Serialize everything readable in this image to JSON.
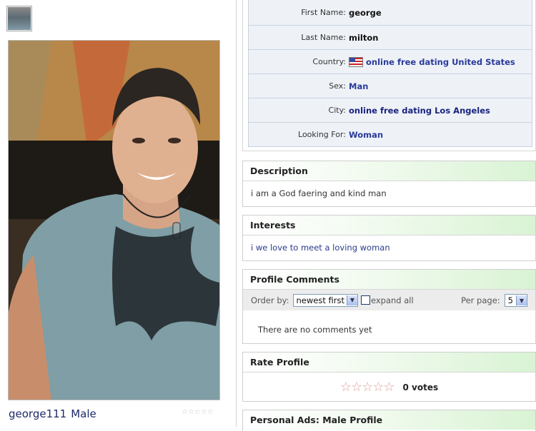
{
  "profile": {
    "username": "george111",
    "gender_label": "Male"
  },
  "info": {
    "rows": [
      {
        "label": "First Name:",
        "value": "george"
      },
      {
        "label": "Last Name:",
        "value": "milton"
      },
      {
        "label": "Country:",
        "value": "online free dating United States"
      },
      {
        "label": "Sex:",
        "value": "Man"
      },
      {
        "label": "City:",
        "value": "online free dating Los Angeles"
      },
      {
        "label": "Looking For:",
        "value": "Woman"
      }
    ]
  },
  "description": {
    "title": "Description",
    "text": "i am a God faering and kind man"
  },
  "interests": {
    "title": "Interests",
    "text": "i we love to meet a loving woman"
  },
  "comments": {
    "title": "Profile Comments",
    "order_label": "Order by:",
    "order_selected": "newest first",
    "expand_label": "expand all",
    "per_page_label": "Per page:",
    "per_page_selected": "5",
    "empty_text": "There are no comments yet"
  },
  "rating": {
    "title": "Rate Profile",
    "stars": "☆☆☆☆☆",
    "votes_text": "0 votes"
  },
  "personal_ads": {
    "title": "Personal Ads: Male Profile"
  },
  "mini_rating": "☆☆☆☆☆",
  "colors": {
    "link": "#2a3a9a",
    "header_gradient_end": "#d9f3d4",
    "info_bg": "#eef2f7"
  }
}
